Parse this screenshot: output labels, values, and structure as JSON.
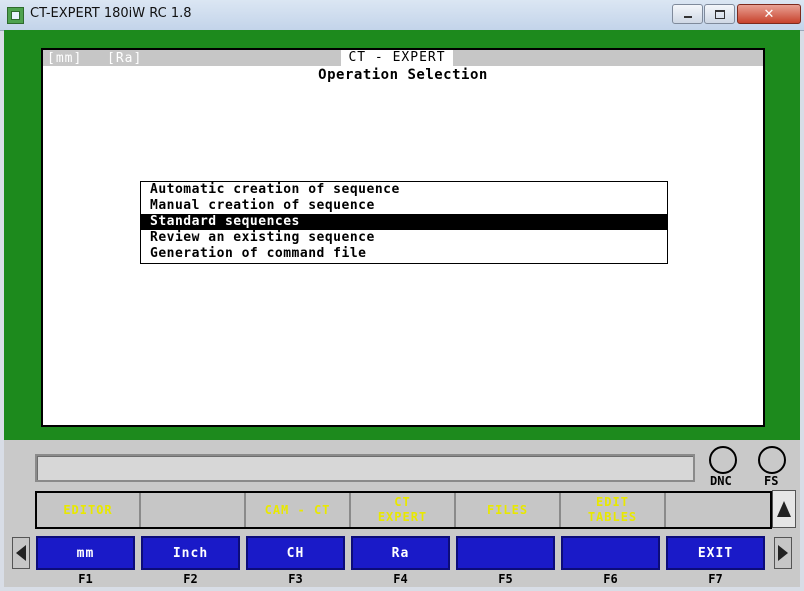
{
  "window": {
    "title": "CT-EXPERT 180iW RC 1.8"
  },
  "screen": {
    "unit_tag": "[mm]",
    "roughness_tag": "[Ra]",
    "app_title": "CT - EXPERT",
    "subtitle": "Operation Selection"
  },
  "menu": {
    "items": [
      "Automatic creation of sequence",
      "Manual creation of sequence",
      "Standard sequences",
      "Review an existing sequence",
      "Generation of command file"
    ],
    "selected_index": 2
  },
  "indicators": {
    "dnc": "DNC",
    "fs": "FS"
  },
  "modes": {
    "editor": "EDITOR",
    "blank": "",
    "cam_ct": "CAM - CT",
    "ct_expert_1": "CT",
    "ct_expert_2": "EXPERT",
    "files": "FILES",
    "edit_tables_1": "EDIT",
    "edit_tables_2": "TABLES",
    "blank2": ""
  },
  "function_keys": {
    "f1": {
      "label": "mm",
      "key": "F1"
    },
    "f2": {
      "label": "Inch",
      "key": "F2"
    },
    "f3": {
      "label": "CH",
      "key": "F3"
    },
    "f4": {
      "label": "Ra",
      "key": "F4"
    },
    "f5": {
      "label": "",
      "key": "F5"
    },
    "f6": {
      "label": "",
      "key": "F6"
    },
    "f7": {
      "label": "EXIT",
      "key": "F7"
    }
  },
  "colors": {
    "frame_green": "#1d8a1d",
    "fkey_blue": "#1a1ac8",
    "mode_yellow": "#e8e800"
  }
}
